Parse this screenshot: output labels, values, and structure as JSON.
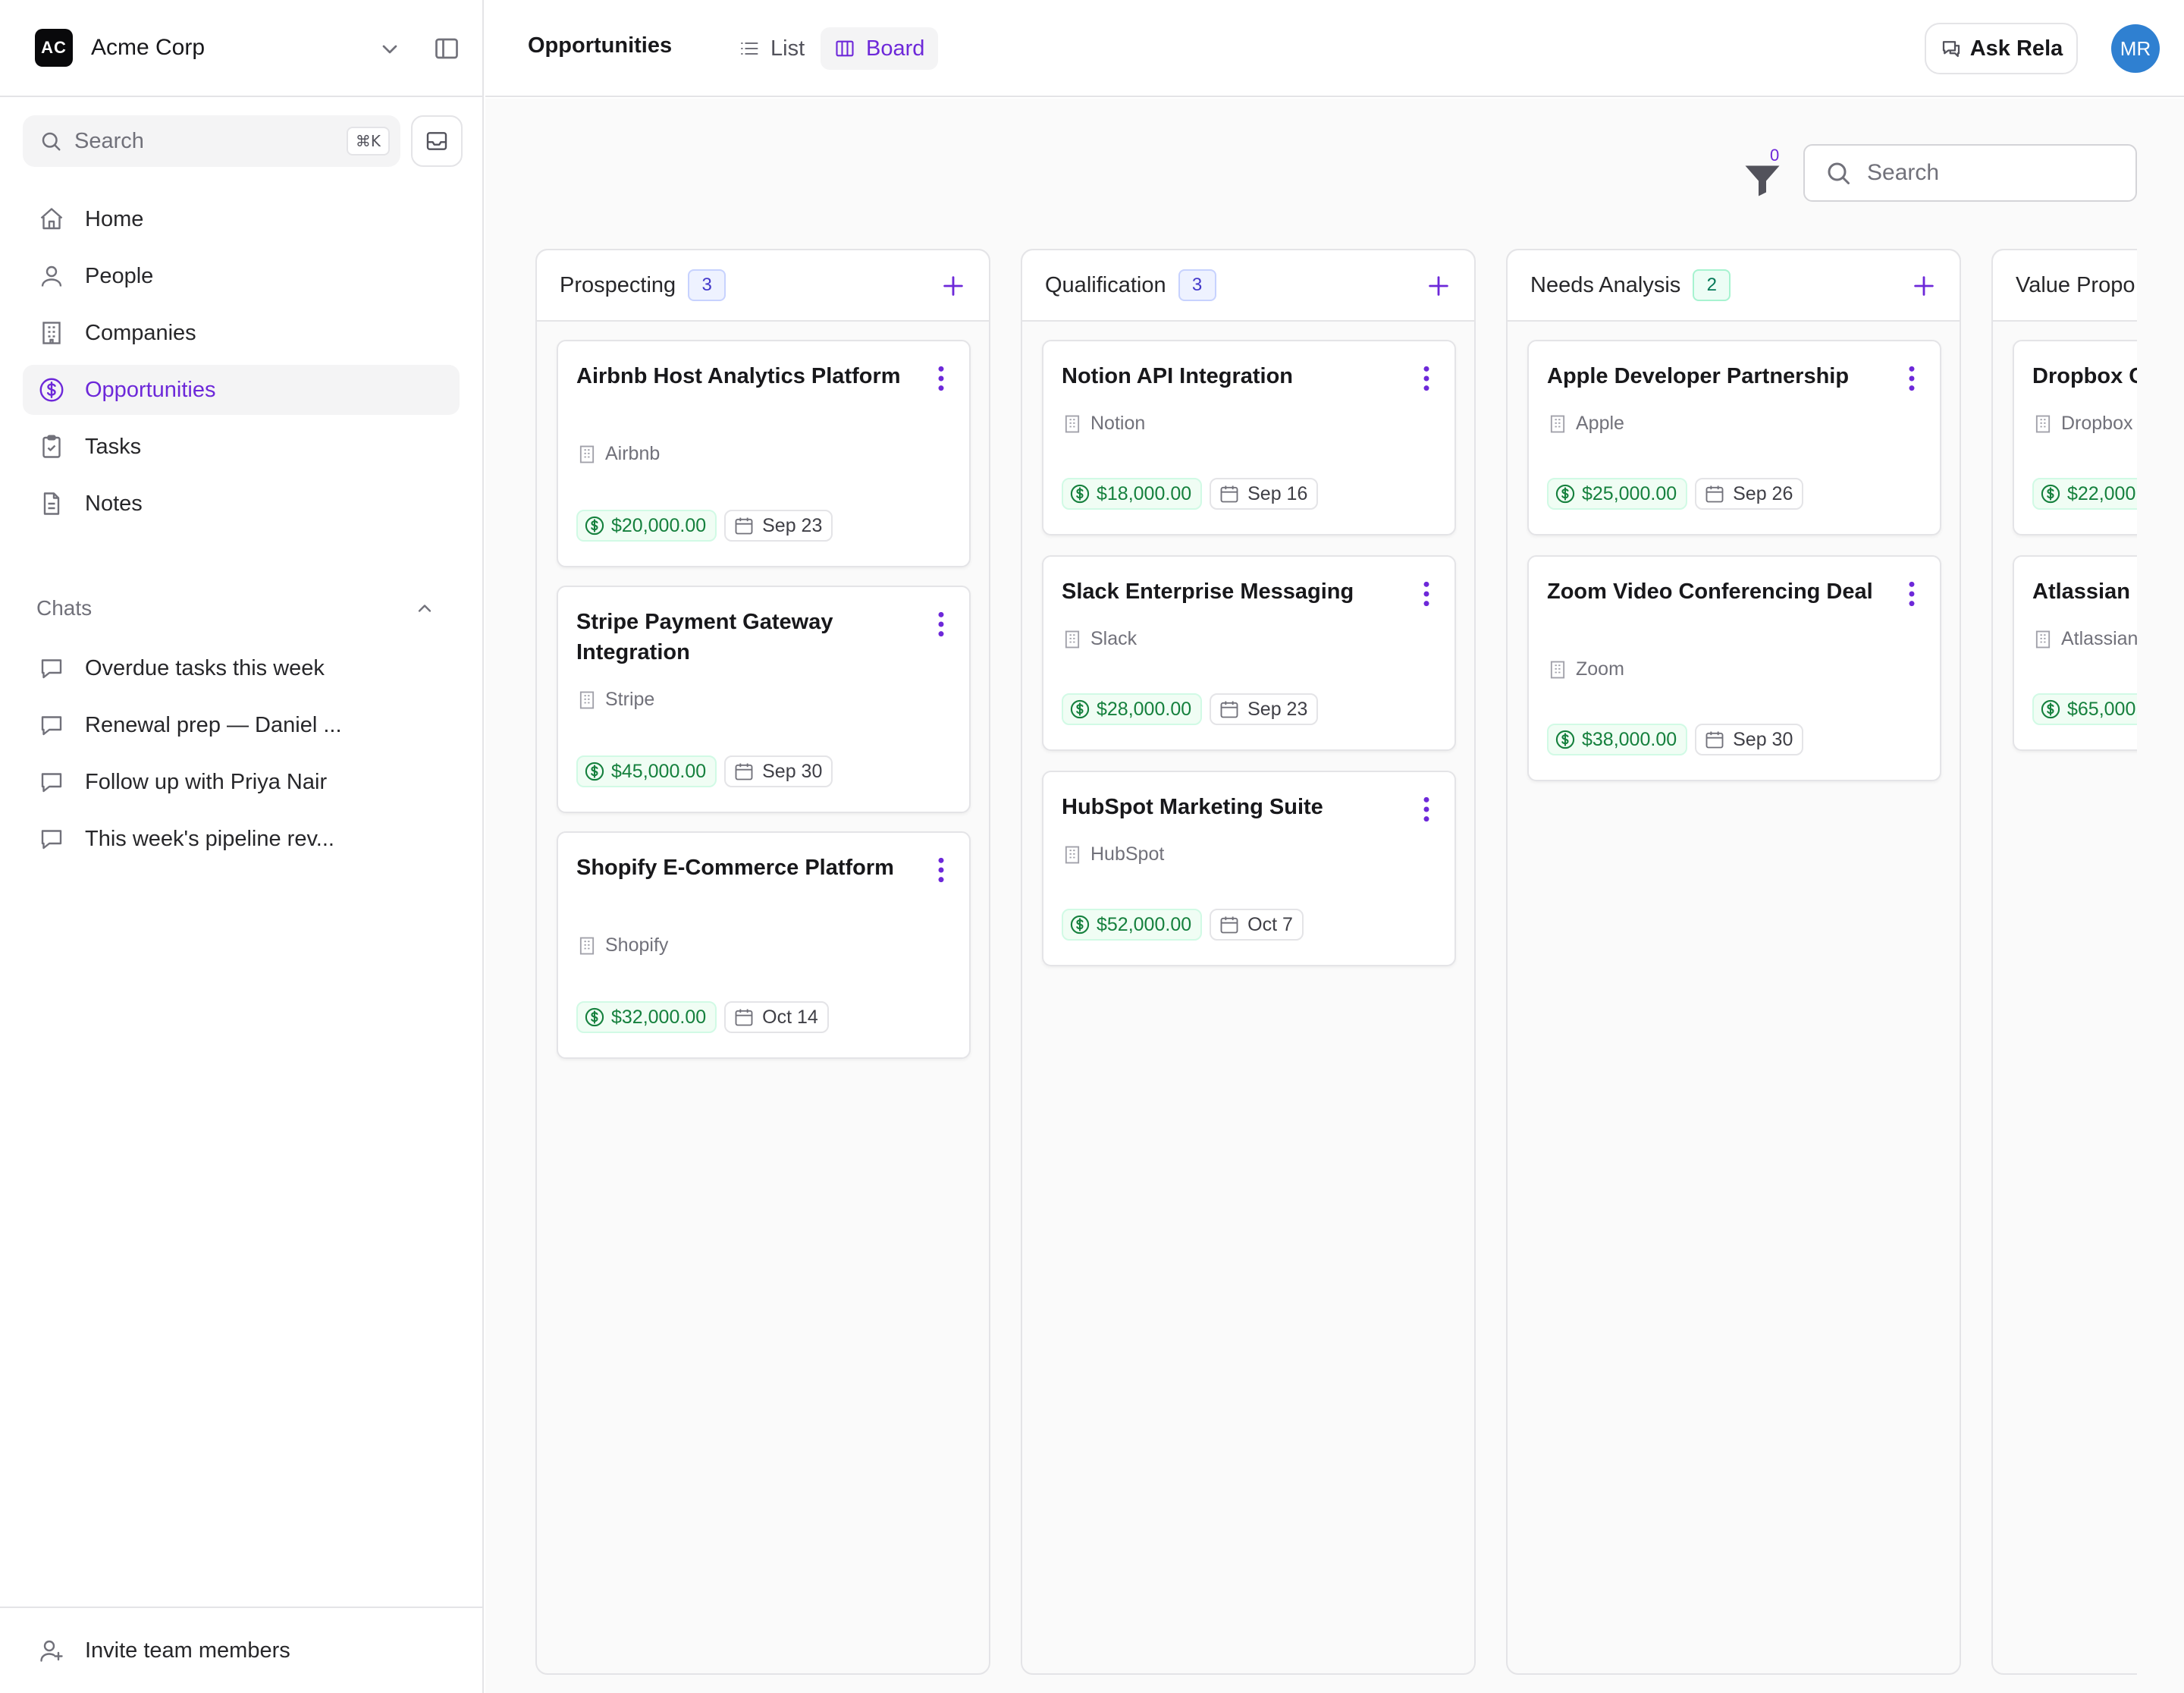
{
  "workspace": {
    "initials": "AC",
    "name": "Acme Corp"
  },
  "sidebar": {
    "search_label": "Search",
    "search_shortcut": "⌘K",
    "nav": [
      {
        "label": "Home",
        "icon": "home-icon"
      },
      {
        "label": "People",
        "icon": "person-icon"
      },
      {
        "label": "Companies",
        "icon": "building-icon"
      },
      {
        "label": "Opportunities",
        "icon": "dollar-icon"
      },
      {
        "label": "Tasks",
        "icon": "clipboard-icon"
      },
      {
        "label": "Notes",
        "icon": "note-icon"
      }
    ],
    "active_nav": "Opportunities",
    "chats_label": "Chats",
    "chats": [
      {
        "label": "Overdue tasks this week"
      },
      {
        "label": "Renewal prep — Daniel ..."
      },
      {
        "label": "Follow up with Priya Nair"
      },
      {
        "label": "This week's pipeline rev..."
      }
    ],
    "footer_label": "Invite team members"
  },
  "topbar": {
    "title": "Opportunities",
    "views": {
      "list": "List",
      "board": "Board"
    },
    "active_view": "Board",
    "ask_label": "Ask Rela",
    "avatar_initials": "MR"
  },
  "board": {
    "filter_count": "0",
    "search_placeholder": "Search",
    "columns": [
      {
        "title": "Prospecting",
        "count": "3",
        "cards": [
          {
            "title": "Airbnb Host Analytics Platform",
            "company": "Airbnb",
            "amount": "$20,000.00",
            "date": "Sep 23"
          },
          {
            "title": "Stripe Payment Gateway Integration",
            "company": "Stripe",
            "amount": "$45,000.00",
            "date": "Sep 30"
          },
          {
            "title": "Shopify E-Commerce Platform",
            "company": "Shopify",
            "amount": "$32,000.00",
            "date": "Oct 14"
          }
        ]
      },
      {
        "title": "Qualification",
        "count": "3",
        "cards": [
          {
            "title": "Notion API Integration",
            "company": "Notion",
            "amount": "$18,000.00",
            "date": "Sep 16"
          },
          {
            "title": "Slack Enterprise Messaging",
            "company": "Slack",
            "amount": "$28,000.00",
            "date": "Sep 23"
          },
          {
            "title": "HubSpot Marketing Suite",
            "company": "HubSpot",
            "amount": "$52,000.00",
            "date": "Oct 7"
          }
        ]
      },
      {
        "title": "Needs Analysis",
        "count": "2",
        "cards": [
          {
            "title": "Apple Developer Partnership",
            "company": "Apple",
            "amount": "$25,000.00",
            "date": "Sep 26"
          },
          {
            "title": "Zoom Video Conferencing Deal",
            "company": "Zoom",
            "amount": "$38,000.00",
            "date": "Sep 30"
          }
        ]
      },
      {
        "title": "Value Propo",
        "cards": [
          {
            "title": "Dropbox C",
            "company": "Dropbox",
            "amount": "$22,000"
          },
          {
            "title": "Atlassian D",
            "company": "Atlassian",
            "amount": "$65,000"
          }
        ]
      }
    ]
  },
  "colors": {
    "accent": "#6d28d9",
    "amount_green": "#15803d",
    "avatar_blue": "#2f80d1"
  }
}
